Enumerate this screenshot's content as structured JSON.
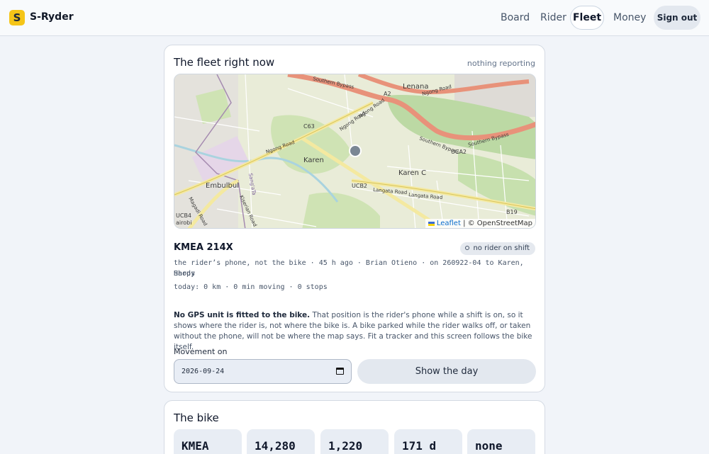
{
  "app": {
    "logo_letter": "S",
    "name": "S-Ryder"
  },
  "nav": {
    "board": "Board",
    "rider": "Rider",
    "fleet": "Fleet",
    "money": "Money",
    "sign_out": "Sign out"
  },
  "fleet_card": {
    "title": "The fleet right now",
    "status": "nothing reporting",
    "map": {
      "places": {
        "lenana": "Lenana",
        "c63": "C63",
        "karen": "Karen",
        "karen_c": "Karen C",
        "embulbul": "Embulbul",
        "ucb2": "UCB2",
        "uca2": "UCA2",
        "b19": "B19",
        "a2": "A2",
        "ucb4": "UCB4",
        "nairobi": "airobi",
        "southern_bypass": "Southern Bypass",
        "southern_bypass_2": "Southern Bypass",
        "southern_bypass_3": "Southern Bypass",
        "ngong_road": "Ngong Road",
        "ngong_road_2": "Ngong Road",
        "ngong_road_3": "Ngong Road",
        "ngong_road_4": "Ngong Road",
        "langata_road": "Langata Road",
        "langata_road_2": "Langata Road",
        "magadi_road": "Magadi Road",
        "kiserian_road": "Kiserian Road",
        "sang": "Sang'aTa"
      },
      "attribution_link": "Leaflet",
      "attribution_text": " | © OpenStreetMap"
    },
    "bike_id": "KMEA 214X",
    "badge": "no rider on shift",
    "detail_line1": "the rider’s phone, not the bike · 45 h ago · Brian Otieno · on 260922-04 to Karen, Hardy",
    "detail_line2": "Shops",
    "today_line": "today: 0 km · 0 min moving · 0 stops",
    "warning_bold": "No GPS unit is fitted to the bike.",
    "warning_text": " That position is the rider's phone while a shift is on, so it shows where the rider is, not where the bike is. A bike parked while the rider walks off, or taken without the phone, will not be where the map says. Fit a tracker and this screen follows the bike itself.",
    "movement_label": "Movement on",
    "movement_date": "2026-09-24",
    "show_button": "Show the day"
  },
  "bike_card": {
    "title": "The bike",
    "stats": [
      "KMEA",
      "14,280",
      "1,220",
      "171 d",
      "none"
    ]
  },
  "colors": {
    "accent_yellow": "#f5c518",
    "page_bg": "#f1f4f9",
    "road_orange": "#e8927a",
    "road_yellow": "#f4e9a0"
  },
  "icons": [
    "logo-icon",
    "map-marker-icon",
    "calendar-icon",
    "ukraine-flag-icon",
    "status-dot-icon"
  ]
}
